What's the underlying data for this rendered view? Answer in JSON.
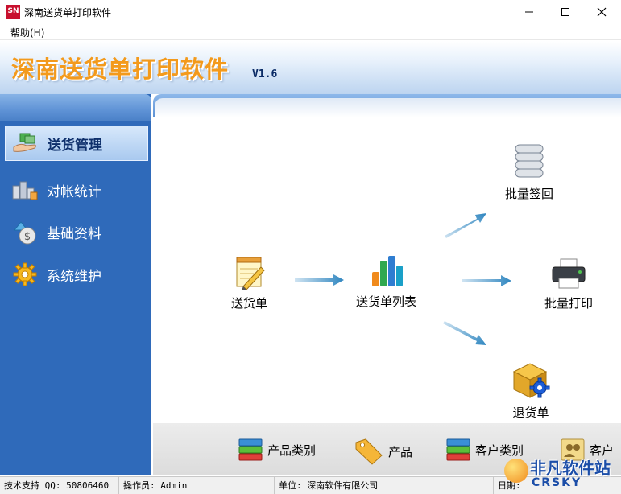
{
  "window": {
    "logo_text": "SN",
    "title": "深南送货单打印软件"
  },
  "menu": {
    "help": "帮助(H)"
  },
  "banner": {
    "title": "深南送货单打印软件",
    "version": "V1.6"
  },
  "sidebar": {
    "items": [
      {
        "label": "送货管理",
        "icon": "delivery-hand-icon",
        "active": true
      },
      {
        "label": "对帐统计",
        "icon": "statistics-icon",
        "active": false
      },
      {
        "label": "基础资料",
        "icon": "money-bag-icon",
        "active": false
      },
      {
        "label": "系统维护",
        "icon": "gear-icon",
        "active": false
      }
    ]
  },
  "flow": {
    "delivery_note": "送货单",
    "delivery_list": "送货单列表",
    "batch_sign": "批量签回",
    "batch_print": "批量打印",
    "return_note": "退货单"
  },
  "quickbar": {
    "items": [
      {
        "label": "产品类别",
        "icon": "category-icon"
      },
      {
        "label": "产品",
        "icon": "tag-icon"
      },
      {
        "label": "客户类别",
        "icon": "category-icon"
      },
      {
        "label": "客户",
        "icon": "customer-icon"
      }
    ]
  },
  "status": {
    "support": "技术支持 QQ: 50806460",
    "operator": "操作员: Admin",
    "company": "单位: 深南软件有限公司",
    "date": "日期:"
  },
  "watermark": {
    "line1": "非凡软件站",
    "line2": "CRSKY"
  },
  "colors": {
    "sidebar": "#2f6aba",
    "banner_title": "#f39a1c",
    "arrow": "#3a8fc8"
  }
}
